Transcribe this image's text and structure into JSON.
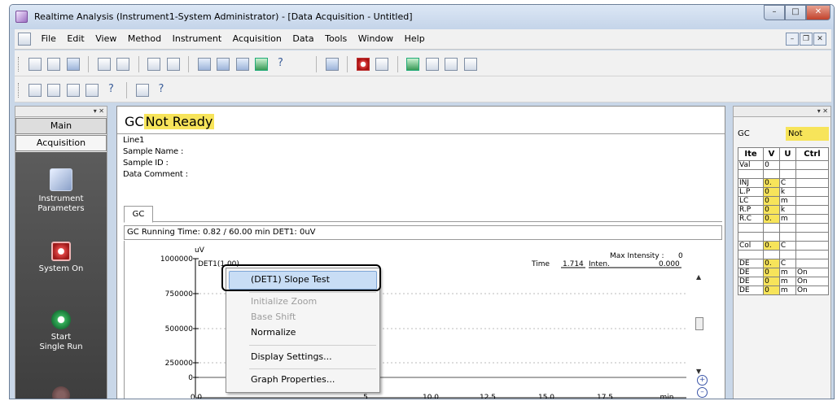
{
  "window": {
    "title": "Realtime Analysis (Instrument1-System Administrator) - [Data Acquisition - Untitled]"
  },
  "menu": [
    "File",
    "Edit",
    "View",
    "Method",
    "Instrument",
    "Acquisition",
    "Data",
    "Tools",
    "Window",
    "Help"
  ],
  "left_panel": {
    "tabs": [
      "Main",
      "Acquisition"
    ],
    "items": [
      {
        "label1": "Instrument",
        "label2": "Parameters",
        "icon": "instrument-parameters-icon"
      },
      {
        "label1": "System On",
        "label2": "",
        "icon": "system-on-icon"
      },
      {
        "label1": "Start",
        "label2": "Single Run",
        "icon": "start-single-run-icon"
      }
    ]
  },
  "center": {
    "status_prefix": "GC",
    "status_text": "Not Ready",
    "info": [
      "Line1",
      "Sample Name :",
      "Sample ID :",
      "Data Comment :"
    ],
    "tab": "GC",
    "running_time": "GC Running Time: 0.82 / 60.00 min DET1: 0uV"
  },
  "graph": {
    "unit": "uV",
    "series_label": "DET1(1.00)",
    "max_intensity_label": "Max Intensity :",
    "max_intensity_value": "0",
    "time_label": "Time",
    "time_value": "1.714",
    "inten_label": "Inten.",
    "inten_value": "0.000",
    "y_ticks": [
      "1000000",
      "750000",
      "500000",
      "250000",
      "0"
    ],
    "x_ticks": [
      "0.0",
      "5",
      "10.0",
      "12.5",
      "15.0",
      "17.5",
      "min"
    ]
  },
  "context_menu": {
    "items": [
      {
        "label": "(DET1) Slope Test",
        "enabled": true,
        "highlighted": true
      },
      {
        "label": "Initialize Zoom",
        "enabled": false
      },
      {
        "label": "Base Shift",
        "enabled": false
      },
      {
        "label": "Normalize",
        "enabled": true
      },
      {
        "label": "Display Settings...",
        "enabled": true
      },
      {
        "label": "Graph Properties...",
        "enabled": true
      }
    ]
  },
  "right_panel": {
    "label": "GC",
    "status": "Not",
    "headers": [
      "Ite",
      "V",
      "U",
      "Ctrl"
    ],
    "rows": [
      [
        "Val",
        "0",
        "",
        ""
      ],
      [
        "",
        "",
        "",
        ""
      ],
      [
        "INJ",
        "0.",
        "C",
        ""
      ],
      [
        "L.P",
        "0",
        "k",
        ""
      ],
      [
        "LC",
        "0",
        "m",
        ""
      ],
      [
        "R.P",
        "0",
        "k",
        ""
      ],
      [
        "R.C",
        "0.",
        "m",
        ""
      ],
      [
        "",
        "",
        "",
        ""
      ],
      [
        "",
        "",
        "",
        ""
      ],
      [
        "Col",
        "0.",
        "C",
        ""
      ],
      [
        "",
        "",
        "",
        ""
      ],
      [
        "DE",
        "0.",
        "C",
        ""
      ],
      [
        "DE",
        "0",
        "m",
        "On"
      ],
      [
        "DE",
        "0",
        "m",
        "On"
      ],
      [
        "DE",
        "0",
        "m",
        "On"
      ]
    ]
  }
}
